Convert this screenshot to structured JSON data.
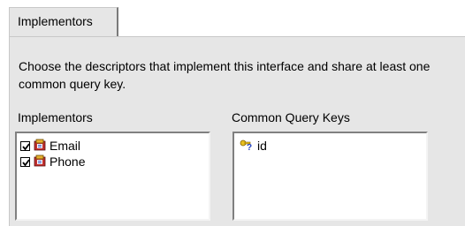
{
  "tab": {
    "label": "Implementors"
  },
  "description": "Choose the descriptors that implement this interface and share at least one common query key.",
  "implementors": {
    "label": "Implementors",
    "items": [
      {
        "label": "Email",
        "checked": true
      },
      {
        "label": "Phone",
        "checked": true
      }
    ]
  },
  "query_keys": {
    "label": "Common Query Keys",
    "items": [
      {
        "label": "id"
      }
    ]
  }
}
